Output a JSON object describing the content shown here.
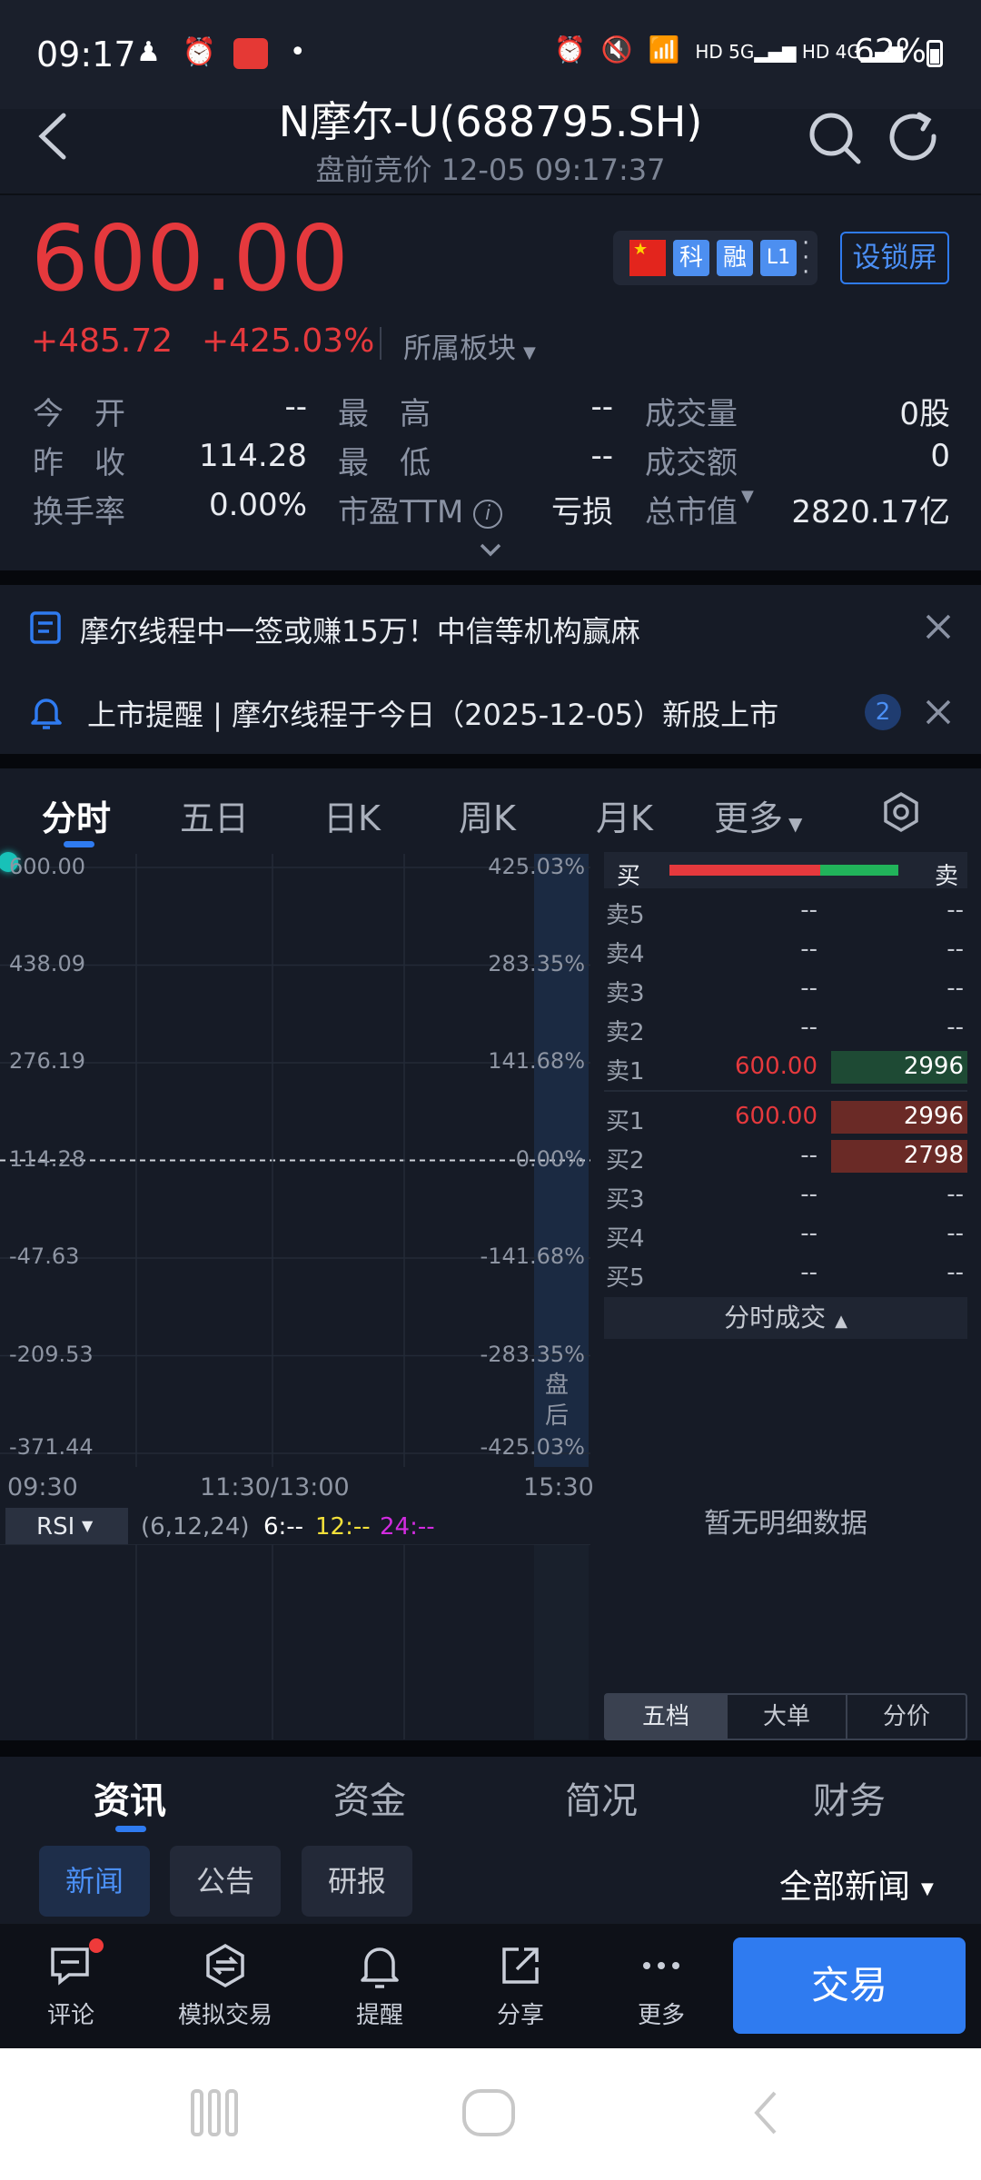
{
  "status_bar": {
    "time": "09:17",
    "battery": "62%"
  },
  "header": {
    "title": "N摩尔-U(688795.SH)",
    "subtitle": "盘前竞价 12-05 09:17:37"
  },
  "quote": {
    "price": "600.00",
    "change": "+485.72",
    "change_pct": "+425.03%",
    "sector_label": "所属板块",
    "lock_button": "设锁屏",
    "badges": [
      "科",
      "融",
      "L1"
    ]
  },
  "stats": {
    "open_label": "今　开",
    "open_value": "--",
    "high_label": "最　高",
    "high_value": "--",
    "volume_label": "成交量",
    "volume_value": "0股",
    "prev_label": "昨　收",
    "prev_value": "114.28",
    "low_label": "最　低",
    "low_value": "--",
    "amount_label": "成交额",
    "amount_value": "0",
    "turnover_label": "换手率",
    "turnover_value": "0.00%",
    "pe_label": "市盈TTM",
    "pe_value": "亏损",
    "cap_label": "总市值",
    "cap_value": "2820.17亿"
  },
  "notices": [
    {
      "text": "摩尔线程中一签或赚15万！中信等机构赢麻"
    },
    {
      "text": "上市提醒 | 摩尔线程于今日（2025-12-05）新股上市",
      "count": "2"
    }
  ],
  "chart_tabs": [
    "分时",
    "五日",
    "日K",
    "周K",
    "月K",
    "更多"
  ],
  "chart": {
    "y_left": [
      "600.00",
      "438.09",
      "276.19",
      "114.28",
      "-47.63",
      "-209.53",
      "-371.44"
    ],
    "y_right": [
      "425.03%",
      "283.35%",
      "141.68%",
      "0.00%",
      "-141.68%",
      "-283.35%",
      "-425.03%"
    ],
    "x_labels": [
      "09:30",
      "11:30/13:00",
      "15:30"
    ],
    "after_hours_label": "盘后",
    "indicator": {
      "name": "RSI",
      "params": "(6,12,24)",
      "v6": "6:--",
      "v12": "12:--",
      "v24": "24:--"
    }
  },
  "orderbook": {
    "buy_label": "买",
    "sell_label": "卖",
    "buy_ratio": 0.66,
    "asks": [
      {
        "label": "卖5",
        "price": "--",
        "volume": "--"
      },
      {
        "label": "卖4",
        "price": "--",
        "volume": "--"
      },
      {
        "label": "卖3",
        "price": "--",
        "volume": "--"
      },
      {
        "label": "卖2",
        "price": "--",
        "volume": "--"
      },
      {
        "label": "卖1",
        "price": "600.00",
        "volume": "2996"
      }
    ],
    "bids": [
      {
        "label": "买1",
        "price": "600.00",
        "volume": "2996"
      },
      {
        "label": "买2",
        "price": "--",
        "volume": "2798"
      },
      {
        "label": "买3",
        "price": "--",
        "volume": "--"
      },
      {
        "label": "买4",
        "price": "--",
        "volume": "--"
      },
      {
        "label": "买5",
        "price": "--",
        "volume": "--"
      }
    ],
    "trades_label": "分时成交",
    "empty_text": "暂无明细数据",
    "tabs": [
      "五档",
      "大单",
      "分价"
    ]
  },
  "info_tabs": [
    "资讯",
    "资金",
    "简况",
    "财务"
  ],
  "news_chips": [
    "新闻",
    "公告",
    "研报"
  ],
  "news_filter": "全部新闻",
  "bottom_nav": [
    {
      "label": "评论",
      "icon": "comment-icon"
    },
    {
      "label": "模拟交易",
      "icon": "simulated-trade-icon"
    },
    {
      "label": "提醒",
      "icon": "bell-icon"
    },
    {
      "label": "分享",
      "icon": "share-icon"
    },
    {
      "label": "更多",
      "icon": "more-icon"
    }
  ],
  "trade_button": "交易",
  "colors": {
    "bg": "#161b26",
    "up": "#e5393d",
    "down": "#21b35a",
    "accent": "#2f7bf0"
  }
}
